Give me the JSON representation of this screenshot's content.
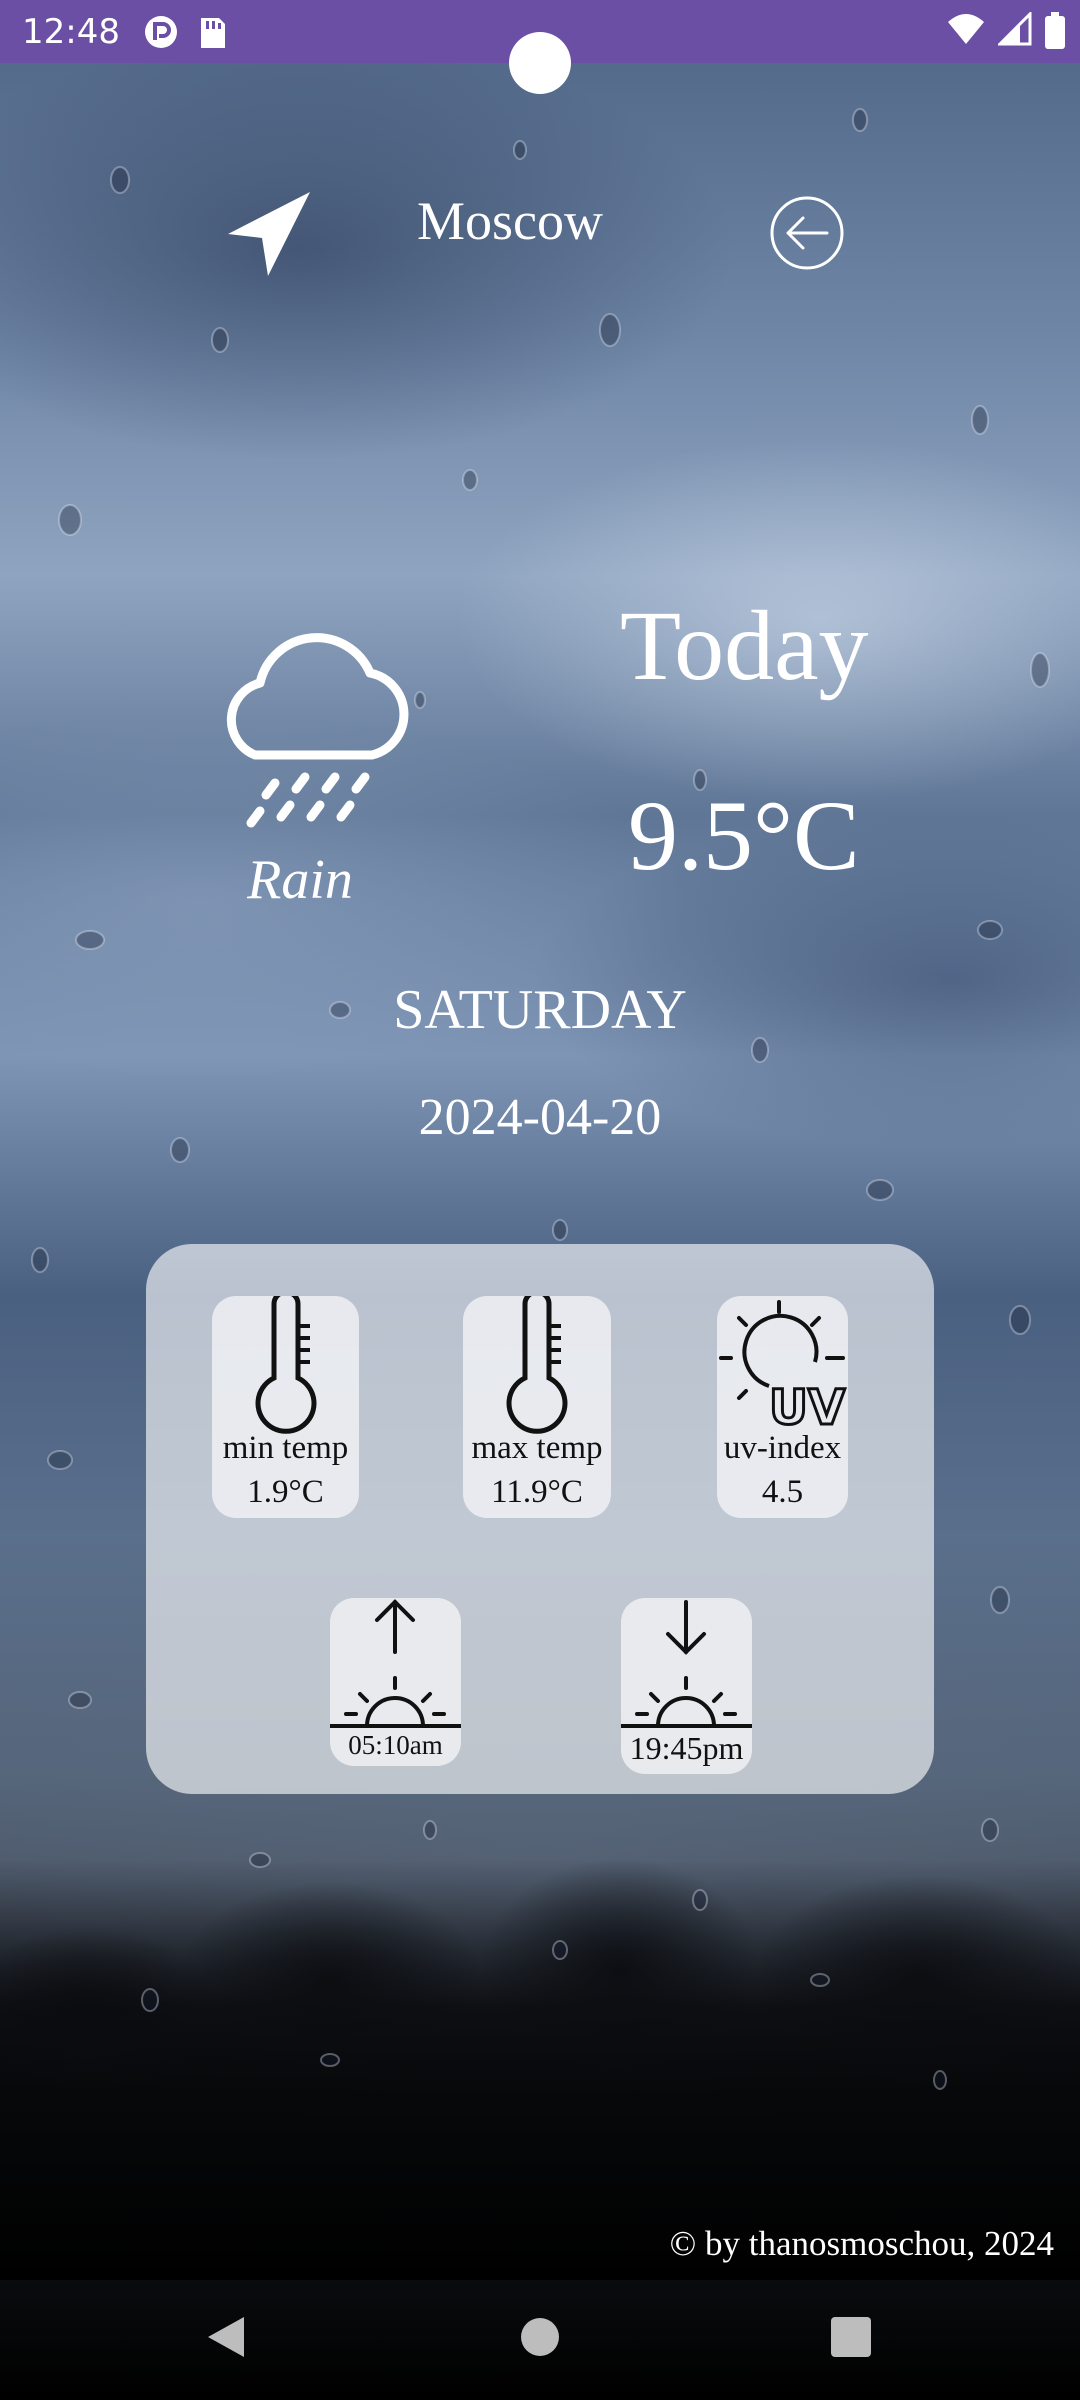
{
  "status_bar": {
    "time": "12:48",
    "left_icons": [
      "parental-control-icon",
      "sd-card-icon"
    ],
    "right_icons": [
      "wifi-icon",
      "signal-icon",
      "battery-icon"
    ]
  },
  "header": {
    "location_icon": "navigation-arrow-icon",
    "city": "Moscow",
    "back_icon": "arrow-left-circle-icon"
  },
  "current": {
    "icon": "cloud-rain-icon",
    "condition": "Rain",
    "day_label": "Today",
    "temperature": "9.5°C",
    "weekday": "SATURDAY",
    "date": "2024-04-20"
  },
  "details": {
    "min_temp": {
      "icon": "thermometer-icon",
      "label": "min temp",
      "value": "1.9°C"
    },
    "max_temp": {
      "icon": "thermometer-icon",
      "label": "max temp",
      "value": "11.9°C"
    },
    "uv_index": {
      "icon": "uv-sun-icon",
      "label": "uv-index",
      "value": "4.5"
    },
    "sunrise": {
      "icon": "sunrise-icon",
      "time": "05:10am"
    },
    "sunset": {
      "icon": "sunset-icon",
      "time": "19:45pm"
    }
  },
  "footer": {
    "credit": "© by thanosmoschou, 2024"
  },
  "nav_bar": {
    "buttons": [
      "back-nav-icon",
      "home-nav-icon",
      "recents-nav-icon"
    ]
  },
  "colors": {
    "status_bar": "#6b4fa5",
    "panel": "rgba(255,255,255,0.62)",
    "text_light": "#ffffff",
    "text_dark": "#111111"
  }
}
